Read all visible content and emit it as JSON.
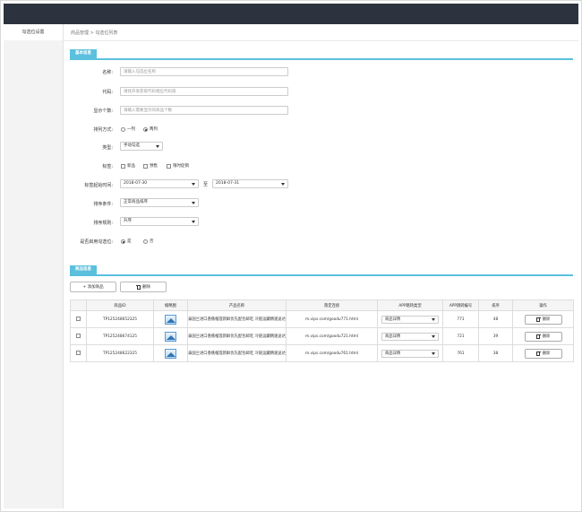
{
  "sidebar": {
    "items": [
      {
        "label": "勾选位设置"
      }
    ]
  },
  "breadcrumb": "商品管理 > 勾选位列表",
  "basic": {
    "section_title": "基本信息",
    "name": {
      "label": "名称:",
      "placeholder": "请输入勾选位名称"
    },
    "code": {
      "label": "代码:",
      "placeholder": "请找开发获取代码相应代码值"
    },
    "display_count": {
      "label": "显示个数:",
      "placeholder": "请输入需要显示的商品个数"
    },
    "layout": {
      "label": "排列方式:",
      "options": [
        "一列",
        "两列"
      ],
      "selected": "两列"
    },
    "type": {
      "label": "类型:",
      "value": "手动勾选"
    },
    "tags": {
      "label": "标签:",
      "options": [
        "新品",
        "预售",
        "限时促销"
      ]
    },
    "tag_time": {
      "label": "标签起始时间:",
      "start": "2018-07-30",
      "to": "至",
      "end": "2018-07-31"
    },
    "sort_condition": {
      "label": "排序条件:",
      "value": "正常商品排序"
    },
    "sort_rule": {
      "label": "排序规则:",
      "value": "升序"
    },
    "enable": {
      "label": "是否启用勾选位:",
      "options": [
        "是",
        "否"
      ],
      "selected": "是"
    }
  },
  "goods": {
    "section_title": "商品信息",
    "add_label": "+ 添加商品",
    "delete_label": "删除",
    "columns": [
      "",
      "商品ID",
      "缩略图",
      "产品名称",
      "落定连接",
      "APP跳转类型",
      "APP跳转编号",
      "排序",
      "操作"
    ],
    "rows": [
      {
        "id": "TP125248652325",
        "name": "泰国兰进口香蕉榴莲新鲜优先配包邮吃 冷链运藏精速送达",
        "link": "m.vips.com/goodu771.html",
        "jump_type": "商品详情",
        "jump_no": "771",
        "order": "48",
        "action": "删除"
      },
      {
        "id": "TP125248674125",
        "name": "泰国兰进口香蕉榴莲新鲜优先配包邮吃 冷链运藏精速送达",
        "link": "m.vips.com/goodu721.html",
        "jump_type": "商品详情",
        "jump_no": "721",
        "order": "39",
        "action": "删除"
      },
      {
        "id": "TP125248622325",
        "name": "泰国兰进口香蕉榴莲新鲜优先配包邮吃 冷链运藏精速送达",
        "link": "m.vips.com/goodu761.html",
        "jump_type": "商品详情",
        "jump_no": "761",
        "order": "38",
        "action": "删除"
      }
    ]
  },
  "colors": {
    "topbar": "#2c333f",
    "accent": "#5bc0de",
    "sidebar": "#f3f3f3"
  }
}
